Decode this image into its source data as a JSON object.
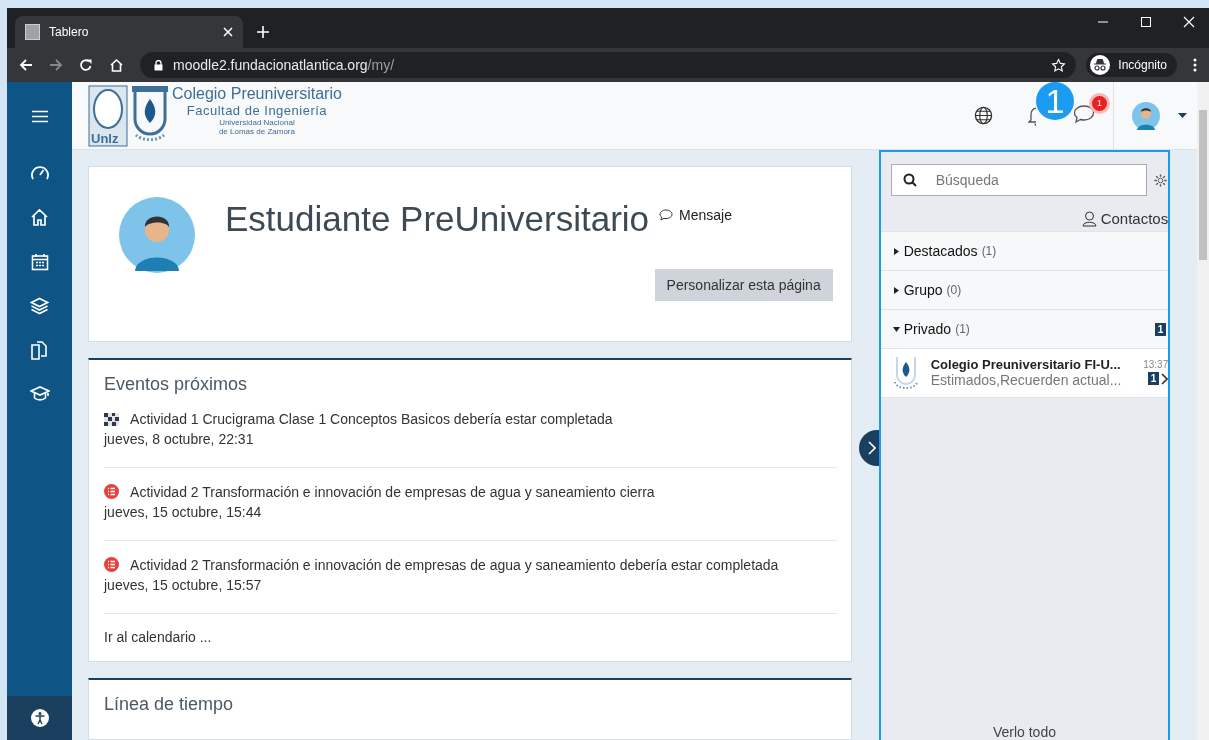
{
  "browser": {
    "tab_title": "Tablero",
    "url_host": "moodle2.fundacionatlantica.org",
    "url_path": "/my/",
    "incognito_label": "Incógnito"
  },
  "header": {
    "logo_mark": "Unlz",
    "logo_title": "Colegio Preuniversitario",
    "logo_subtitle": "Facultad de Ingeniería",
    "logo_line_1": "Universidad Nacional",
    "logo_line_2": "de Lomas de Zamora",
    "message_badge": "1",
    "annotation": "1"
  },
  "profile": {
    "name": "Estudiante PreUniversitario",
    "message_link": "Mensaje",
    "customize_button": "Personalizar esta página"
  },
  "events": {
    "title": "Eventos próximos",
    "items": [
      {
        "kind": "quiz",
        "text": "Actividad 1 Crucigrama Clase 1 Conceptos Basicos debería estar completada",
        "date": "jueves, 8 octubre, 22:31"
      },
      {
        "kind": "assignment",
        "text": "Actividad 2 Transformación e innovación de empresas de agua y saneamiento cierra",
        "date": "jueves, 15 octubre, 15:44"
      },
      {
        "kind": "assignment",
        "text": "Actividad 2 Transformación e innovación de empresas de agua y saneamiento debería estar completada",
        "date": "jueves, 15 octubre, 15:57"
      }
    ],
    "calendar_link": "Ir al calendario ..."
  },
  "timeline": {
    "title": "Línea de tiempo"
  },
  "drawer": {
    "search": {
      "placeholder": "Búsqueda"
    },
    "contacts": "Contactos",
    "sections": [
      {
        "label": "Destacados",
        "count": "(1)",
        "expanded": false
      },
      {
        "label": "Grupo",
        "count": "(0)",
        "expanded": false
      },
      {
        "label": "Privado",
        "count": "(1)",
        "expanded": true,
        "unread": "1"
      }
    ],
    "conversations": [
      {
        "name": "Colegio Preuniversitario FI-U...",
        "preview": "Estimados,Recuerden actual...",
        "time": "13:37",
        "unread": "1"
      }
    ],
    "footer": "Verlo todo"
  }
}
